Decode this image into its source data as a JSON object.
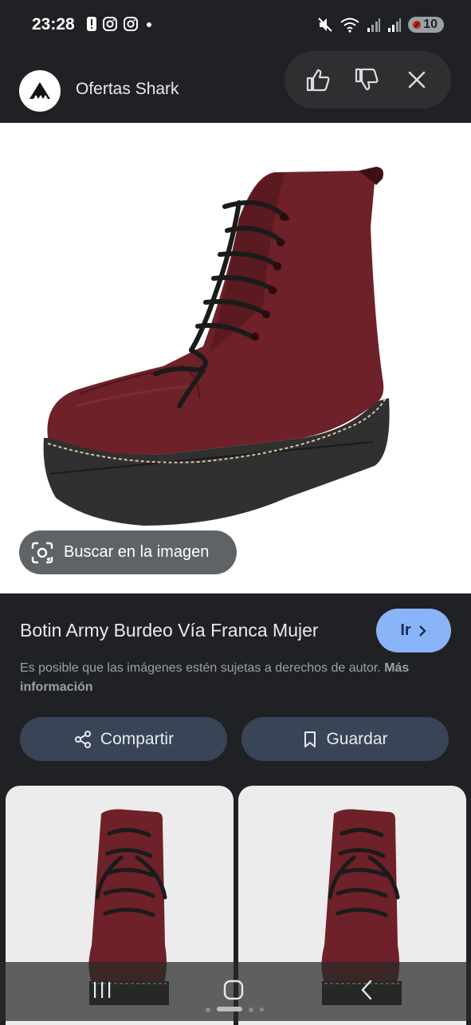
{
  "status_bar": {
    "time": "23:28",
    "left_icons": [
      "alert-icon",
      "instagram-icon",
      "instagram-icon",
      "dot-icon"
    ],
    "right_icons": [
      "mute-icon",
      "wifi-icon",
      "signal-icon",
      "signal-icon"
    ],
    "battery": "10"
  },
  "header": {
    "source_name": "Ofertas Shark",
    "avatar_icon": "shark-logo-icon",
    "feedback_icons": [
      "thumbs-up-icon",
      "thumbs-down-icon",
      "close-icon"
    ]
  },
  "image_panel": {
    "lens_label": "Buscar en la imagen"
  },
  "result": {
    "title": "Botin Army Burdeo Vía Franca Mujer",
    "go_label": "Ir",
    "disclaimer": "Es posible que las imágenes estén sujetas a derechos de autor.",
    "more_info": "Más información"
  },
  "actions": {
    "share_label": "Compartir",
    "save_label": "Guardar"
  },
  "colors": {
    "background": "#202124",
    "accent": "#8ab4f8",
    "action_button": "#394457",
    "boot": "#6e2128"
  },
  "navbar": {
    "icons": [
      "recent-apps-icon",
      "home-icon",
      "back-icon"
    ]
  }
}
